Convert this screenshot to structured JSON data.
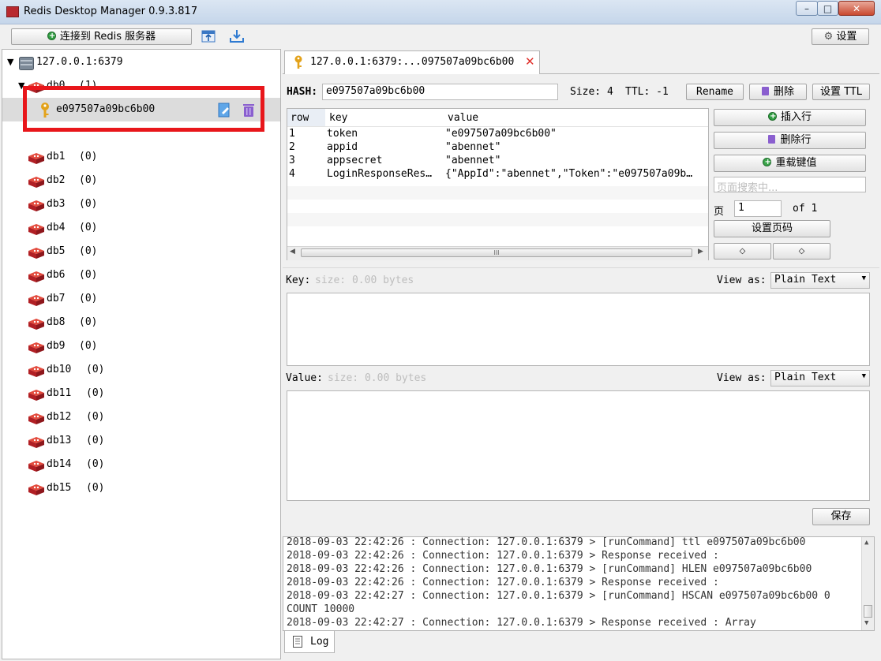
{
  "window": {
    "title": "Redis Desktop Manager 0.9.3.817",
    "min": "–",
    "max": "□",
    "close": "✕"
  },
  "toolbar": {
    "connect_label": "连接到 Redis 服务器",
    "settings_label": "设置"
  },
  "tree": {
    "server": "127.0.0.1:6379",
    "db0": {
      "name": "db0",
      "count": "(1)"
    },
    "key": "e097507a09bc6b00",
    "dbs": [
      {
        "name": "db1",
        "count": "(0)"
      },
      {
        "name": "db2",
        "count": "(0)"
      },
      {
        "name": "db3",
        "count": "(0)"
      },
      {
        "name": "db4",
        "count": "(0)"
      },
      {
        "name": "db5",
        "count": "(0)"
      },
      {
        "name": "db6",
        "count": "(0)"
      },
      {
        "name": "db7",
        "count": "(0)"
      },
      {
        "name": "db8",
        "count": "(0)"
      },
      {
        "name": "db9",
        "count": "(0)"
      },
      {
        "name": "db10",
        "count": "(0)"
      },
      {
        "name": "db11",
        "count": "(0)"
      },
      {
        "name": "db12",
        "count": "(0)"
      },
      {
        "name": "db13",
        "count": "(0)"
      },
      {
        "name": "db14",
        "count": "(0)"
      },
      {
        "name": "db15",
        "count": "(0)"
      }
    ]
  },
  "tab": {
    "label": "127.0.0.1:6379:...097507a09bc6b00",
    "close": "✕"
  },
  "hash": {
    "label": "HASH:",
    "key_value": "e097507a09bc6b00",
    "size_label": "Size: 4",
    "ttl_label": "TTL: -1",
    "rename": "Rename",
    "delete": "删除",
    "set_ttl": "设置 TTL"
  },
  "table": {
    "headers": [
      "row",
      "key",
      "value"
    ],
    "rows": [
      {
        "row": "1",
        "key": "token",
        "value": "\"e097507a09bc6b00\""
      },
      {
        "row": "2",
        "key": "appid",
        "value": "\"abennet\""
      },
      {
        "row": "3",
        "key": "appsecret",
        "value": "\"abennet\""
      },
      {
        "row": "4",
        "key": "LoginResponseRes…",
        "value": "{\"AppId\":\"abennet\",\"Token\":\"e097507a09b…"
      }
    ],
    "scroll_mark": "III"
  },
  "side": {
    "insert_row": "插入行",
    "delete_row": "删除行",
    "reload": "重载键值",
    "search_placeholder": "页面搜索中...",
    "page_label": "页",
    "page_value": "1",
    "of_label": "of 1",
    "set_page": "设置页码",
    "prev": "◇",
    "next": "◇"
  },
  "key_editor": {
    "label": "Key:",
    "size": "size: 0.00 bytes",
    "view_as": "View as:",
    "format": "Plain Text"
  },
  "value_editor": {
    "label": "Value:",
    "size": "size: 0.00 bytes",
    "view_as": "View as:",
    "format": "Plain Text"
  },
  "save": "保存",
  "log": {
    "lines": [
      "2018-09-03 22:42:26 : Connection: 127.0.0.1:6379 > [runCommand] ttl e097507a09bc6b00",
      "2018-09-03 22:42:26 : Connection: 127.0.0.1:6379 > Response received :",
      "2018-09-03 22:42:26 : Connection: 127.0.0.1:6379 > [runCommand] HLEN e097507a09bc6b00",
      "2018-09-03 22:42:26 : Connection: 127.0.0.1:6379 > Response received :",
      "2018-09-03 22:42:27 : Connection: 127.0.0.1:6379 > [runCommand] HSCAN e097507a09bc6b00 0",
      "COUNT 10000",
      "2018-09-03 22:42:27 : Connection: 127.0.0.1:6379 > Response received : Array"
    ],
    "tab": "Log"
  },
  "colors": {
    "highlight_red": "#e8161b",
    "db_red": "#c8282c",
    "key_yellow": "#e3a21a"
  }
}
